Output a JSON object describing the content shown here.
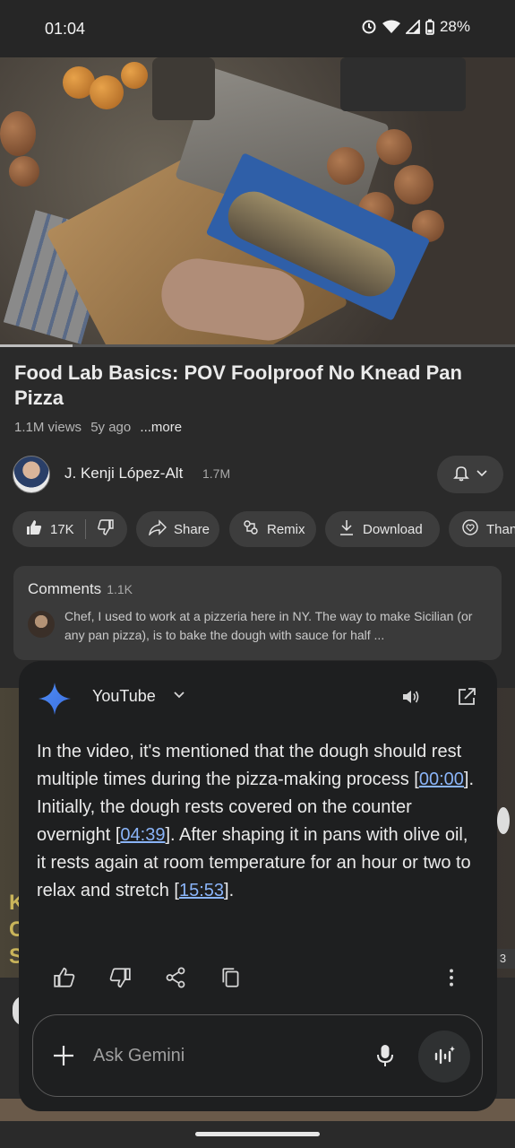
{
  "status_bar": {
    "time": "01:04",
    "battery": "28%"
  },
  "video": {
    "progress": 0.14
  },
  "info": {
    "title": "Food Lab Basics: POV Foolproof No Knead Pan Pizza",
    "views": "1.1M views",
    "age": "5y ago",
    "more": "...more"
  },
  "channel": {
    "name": "J. Kenji López-Alt",
    "subscribers": "1.7M"
  },
  "actions": {
    "likes": "17K",
    "share": "Share",
    "remix": "Remix",
    "download": "Download",
    "thanks": "Thanks"
  },
  "comments": {
    "label": "Comments",
    "count": "1.1K",
    "top_comment": "Chef, I used to work at a pizzeria here in NY. The way to make Sicilian (or any pan pizza), is to bake the dough with sauce for half ..."
  },
  "background": {
    "side_number": "3",
    "thumb_letters": [
      "K",
      "C",
      "S"
    ]
  },
  "gemini": {
    "source": "YouTube",
    "answer": {
      "part1": "In the video, it's mentioned that the dough should rest multiple times during the pizza-making process [",
      "ts1": "00:00",
      "part2": "]. Initially, the dough rests covered on the counter overnight [",
      "ts2": "04:39",
      "part3": "]. After shaping it in pans with olive oil, it rests again at room temperature for an hour or two to relax and stretch [",
      "ts3": "15:53",
      "part4": "]."
    },
    "input_placeholder": "Ask Gemini"
  },
  "colors": {
    "link": "#8ab4f8",
    "panel_bg": "#1e1f20",
    "page_bg": "#2a2a2a",
    "chip_bg": "#3d3d3d"
  },
  "icons": [
    "alarm-icon",
    "wifi-icon",
    "signal-icon",
    "battery-icon",
    "bell-icon",
    "chevron-down-icon",
    "thumbs-up-icon",
    "thumbs-down-icon",
    "share-icon",
    "remix-icon",
    "download-icon",
    "thanks-icon",
    "gemini-spark-icon",
    "speaker-icon",
    "open-external-icon",
    "copy-icon",
    "more-vert-icon",
    "plus-icon",
    "mic-icon",
    "live-icon"
  ]
}
